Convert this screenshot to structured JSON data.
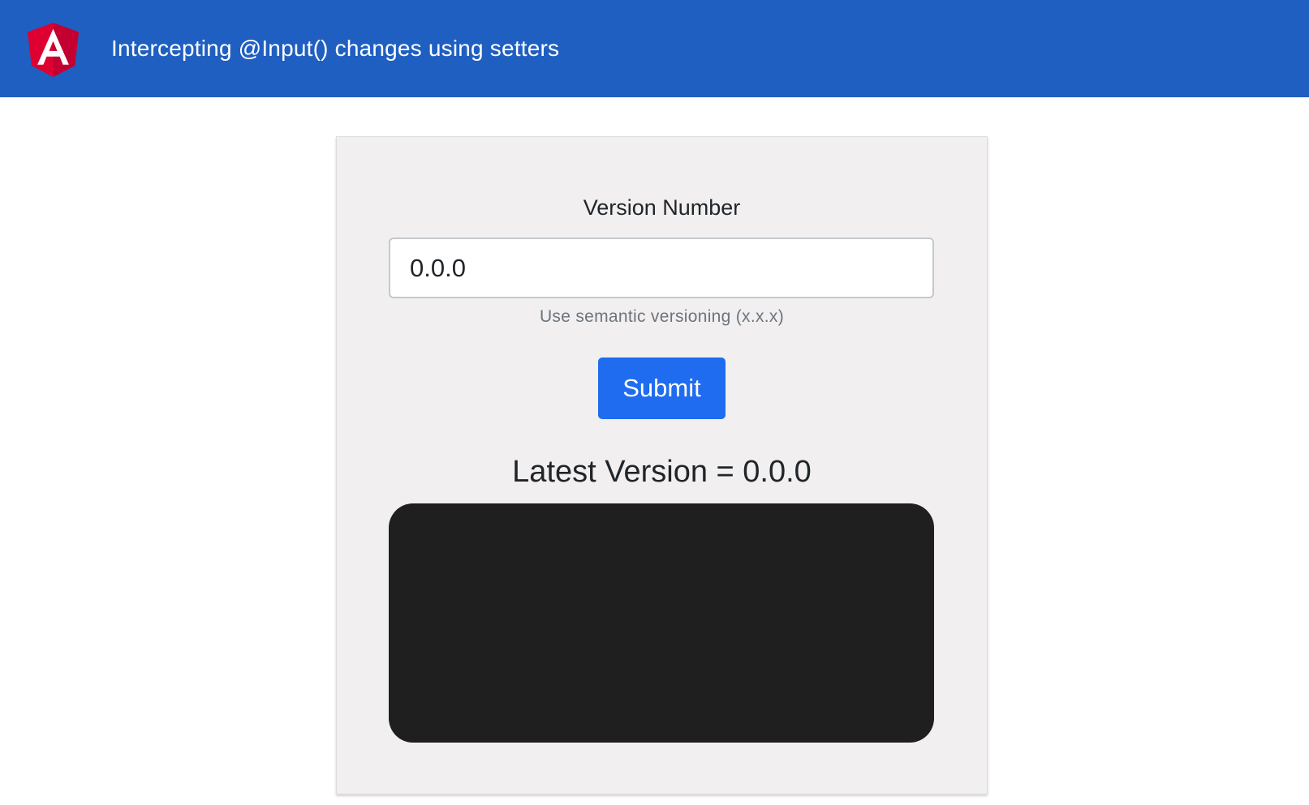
{
  "header": {
    "title": "Intercepting @Input() changes using setters",
    "logo_icon": "angular-logo-icon",
    "background_color": "#1f5fc1"
  },
  "form": {
    "label": "Version Number",
    "input_value": "0.0.0",
    "help_text": "Use semantic versioning (x.x.x)",
    "submit_label": "Submit",
    "accent_color": "#1f6cf0"
  },
  "result": {
    "latest_version_text": "Latest Version = 0.0.0",
    "panel_color": "#1f1f1f"
  }
}
